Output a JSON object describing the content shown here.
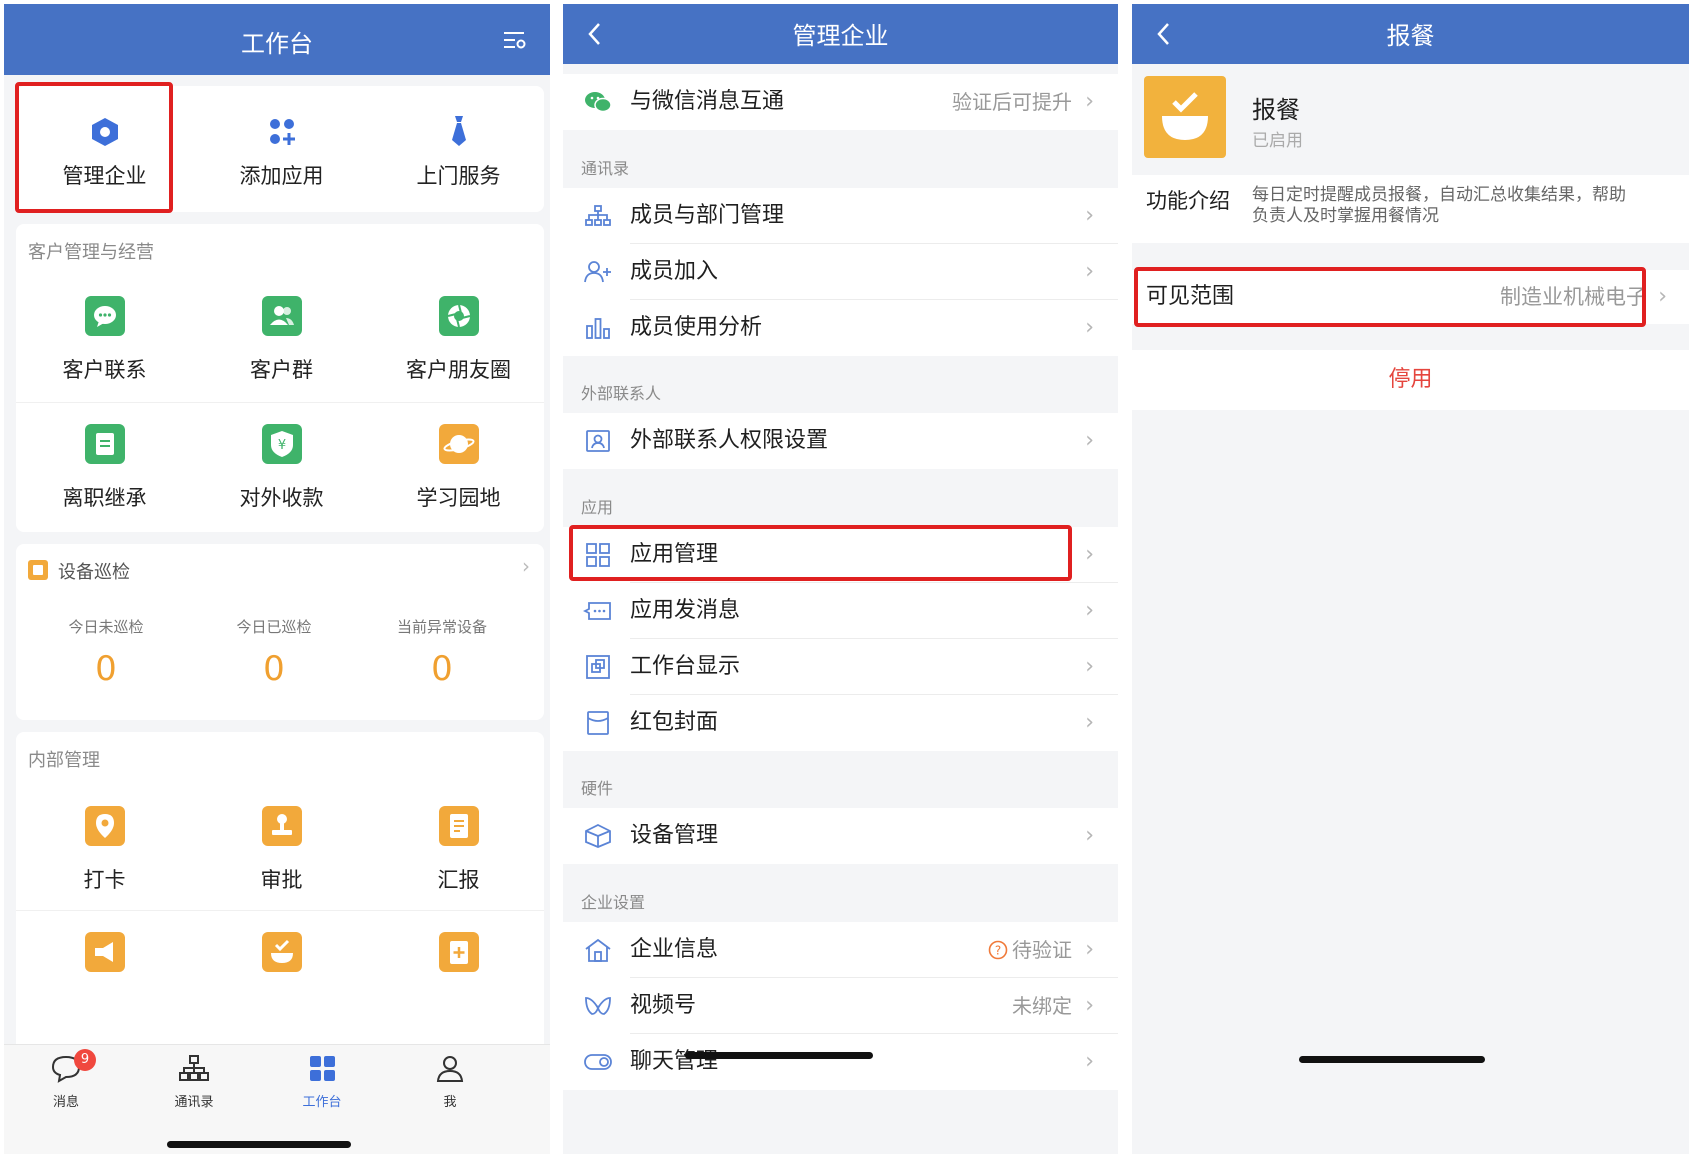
{
  "panel1": {
    "title": "工作台",
    "top": [
      {
        "label": "管理企业"
      },
      {
        "label": "添加应用"
      },
      {
        "label": "上门服务"
      }
    ],
    "section1": {
      "title": "客户管理与经营",
      "items": [
        {
          "label": "客户联系"
        },
        {
          "label": "客户群"
        },
        {
          "label": "客户朋友圈"
        },
        {
          "label": "离职继承"
        },
        {
          "label": "对外收款"
        },
        {
          "label": "学习园地"
        }
      ]
    },
    "inspection": {
      "title": "设备巡检",
      "stats": [
        {
          "label": "今日未巡检",
          "value": "0"
        },
        {
          "label": "今日已巡检",
          "value": "0"
        },
        {
          "label": "当前异常设备",
          "value": "0"
        }
      ]
    },
    "section2": {
      "title": "内部管理",
      "items": [
        {
          "label": "打卡"
        },
        {
          "label": "审批"
        },
        {
          "label": "汇报"
        }
      ]
    },
    "tabbar": {
      "badge": "9",
      "tabs": [
        {
          "label": "消息"
        },
        {
          "label": "通讯录"
        },
        {
          "label": "工作台"
        },
        {
          "label": "我"
        }
      ]
    },
    "colors": {
      "header": "#4672c4",
      "green": "#3fb36a",
      "orange": "#f2a93b",
      "accent": "#3d6fd9",
      "highlight": "#e02020"
    }
  },
  "panel2": {
    "title": "管理企业",
    "wechat": {
      "label": "与微信消息互通",
      "value": "验证后可提升"
    },
    "groups": [
      {
        "title": "通讯录",
        "rows": [
          {
            "label": "成员与部门管理",
            "icon": "org-chart-icon"
          },
          {
            "label": "成员加入",
            "icon": "add-member-icon"
          },
          {
            "label": "成员使用分析",
            "icon": "bar-chart-icon"
          }
        ]
      },
      {
        "title": "外部联系人",
        "rows": [
          {
            "label": "外部联系人权限设置",
            "icon": "contact-card-icon"
          }
        ]
      },
      {
        "title": "应用",
        "rows": [
          {
            "label": "应用管理",
            "icon": "grid-icon"
          },
          {
            "label": "应用发消息",
            "icon": "message-icon"
          },
          {
            "label": "工作台显示",
            "icon": "window-icon"
          },
          {
            "label": "红包封面",
            "icon": "envelope-icon"
          }
        ]
      },
      {
        "title": "硬件",
        "rows": [
          {
            "label": "设备管理",
            "icon": "cube-icon"
          }
        ]
      },
      {
        "title": "企业设置",
        "rows": [
          {
            "label": "企业信息",
            "icon": "home-icon",
            "value": "待验证"
          },
          {
            "label": "视频号",
            "icon": "butterfly-icon",
            "value": "未绑定"
          },
          {
            "label": "聊天管理",
            "icon": "chat-toggle-icon"
          }
        ]
      }
    ]
  },
  "panel3": {
    "title": "报餐",
    "app": {
      "name": "报餐",
      "status": "已启用"
    },
    "intro": {
      "label": "功能介绍",
      "text_line1": "每日定时提醒成员报餐，自动汇总收集结果，帮助",
      "text_line2": "负责人及时掌握用餐情况"
    },
    "scope": {
      "label": "可见范围",
      "value": "制造业机械电子"
    },
    "disable": "停用"
  }
}
